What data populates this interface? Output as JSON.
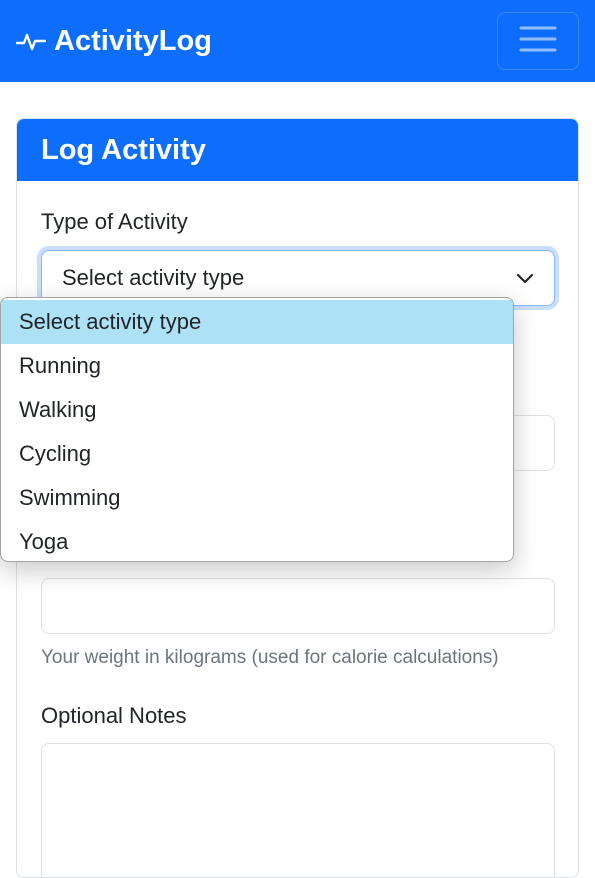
{
  "navbar": {
    "brand_name": "ActivityLog",
    "brand_icon": "activity-pulse-icon",
    "menu_icon": "hamburger-menu-icon"
  },
  "card": {
    "title": "Log Activity"
  },
  "form": {
    "activity_type_label": "Type of Activity",
    "activity_type_selected": "Select activity type",
    "weight_help": "Your weight in kilograms (used for calorie calculations)",
    "notes_label": "Optional Notes"
  },
  "dropdown": {
    "options": [
      "Select activity type",
      "Running",
      "Walking",
      "Cycling",
      "Swimming",
      "Yoga"
    ],
    "selected_index": 0
  },
  "colors": {
    "primary": "#0d6efd",
    "option_highlight": "#ade1f5"
  }
}
